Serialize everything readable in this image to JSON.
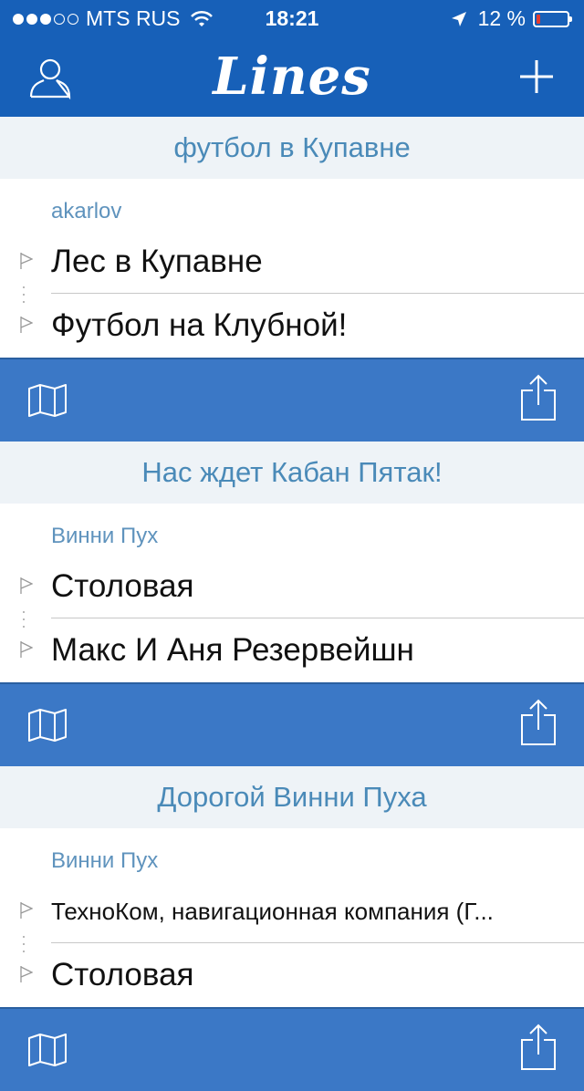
{
  "status": {
    "carrier": "MTS RUS",
    "time": "18:21",
    "battery": "12 %",
    "battery_level": 0.12,
    "signal_bars": 3
  },
  "nav": {
    "title": "Lines"
  },
  "cards": [
    {
      "title": "футбол в Купавне",
      "author": "akarlov",
      "points": [
        "Лес в Купавне",
        "Футбол на Клубной!"
      ]
    },
    {
      "title": "Нас ждет Кабан Пятак!",
      "author": "Винни Пух",
      "points": [
        "Столовая",
        "Макс И Аня Резервейшн"
      ]
    },
    {
      "title": "Дорогой Винни Пуха",
      "author": "Винни Пух",
      "points": [
        "ТехноКом, навигационная компания (Г...",
        "Столовая"
      ]
    }
  ]
}
